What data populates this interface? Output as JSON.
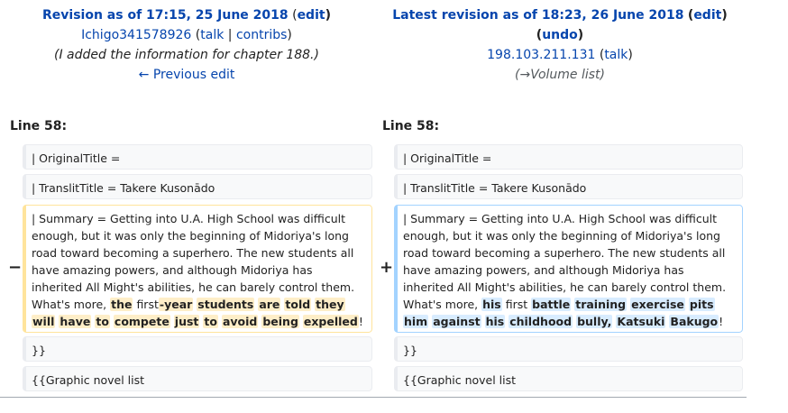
{
  "left_header": {
    "title": "Revision as of 17:15, 25 June 2018",
    "edit_label": "edit",
    "user": "Ichigo341578926",
    "talk_label": "talk",
    "contribs_label": "contribs",
    "summary": "(I added the information for chapter 188.)",
    "prev_edit": "← Previous edit"
  },
  "right_header": {
    "title": "Latest revision as of 18:23, 26 June 2018",
    "edit_label": "edit",
    "undo_label": "undo",
    "user": "198.103.211.131",
    "talk_label": "talk",
    "summary_arrow": "(→",
    "summary_text": "Volume list",
    "summary_close": ")"
  },
  "left_line": "Line 58:",
  "right_line": "Line 58:",
  "rows": {
    "original_title": "| OriginalTitle =",
    "translit_title": "| TranslitTitle = Takere Kusonādo",
    "closing": "}}",
    "graphic_novel": "{{Graphic novel list"
  },
  "summary_common": "| Summary     = Getting into U.A. High School was difficult enough, but it was only the beginning of Midoriya's long road toward becoming a superhero. The new students all have amazing powers, and although Midoriya has inherited All Might's abilities, he can barely control them. What's more, ",
  "removed": {
    "w1": "the",
    "w2": "first",
    "w3": "-year",
    "w4": "students",
    "w5": "are",
    "w6": "told",
    "w7": "they",
    "w8": "will",
    "w9": "have",
    "w10": "to",
    "w11": "compete",
    "w12": "just",
    "w13": "to",
    "w14": "avoid",
    "w15": "being",
    "w16": "expelled",
    "end": "!"
  },
  "added": {
    "w1": "his",
    "w2": "first",
    "w3": "battle",
    "w4": "training",
    "w5": "exercise",
    "w6": "pits",
    "w7": "him",
    "w8": "against",
    "w9": "his",
    "w10": "childhood",
    "w11": "bully,",
    "w12": "Katsuki",
    "w13": "Bakugo",
    "end": "!"
  },
  "markers": {
    "minus": "−",
    "plus": "+"
  }
}
